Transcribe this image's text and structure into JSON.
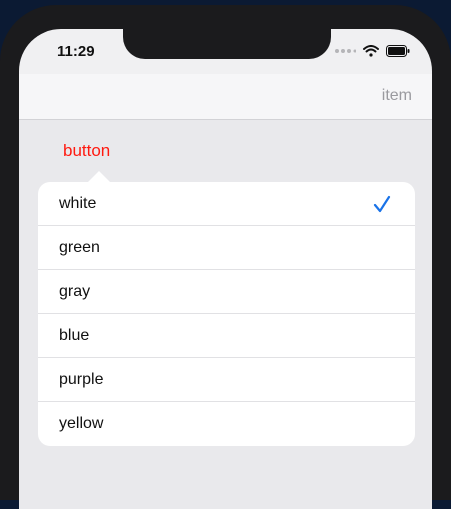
{
  "status_bar": {
    "time": "11:29",
    "icons": [
      "signal-dots-icon",
      "wifi-icon",
      "battery-icon"
    ]
  },
  "navbar": {
    "right_item": "item"
  },
  "content": {
    "button_label": "button"
  },
  "menu": {
    "items": [
      {
        "label": "white",
        "selected": true
      },
      {
        "label": "green",
        "selected": false
      },
      {
        "label": "gray",
        "selected": false
      },
      {
        "label": "blue",
        "selected": false
      },
      {
        "label": "purple",
        "selected": false
      },
      {
        "label": "yellow",
        "selected": false
      }
    ]
  },
  "colors": {
    "accent_red": "#ff1a10",
    "check_blue": "#1a73e8",
    "nav_item_gray": "#9a9a9f"
  }
}
